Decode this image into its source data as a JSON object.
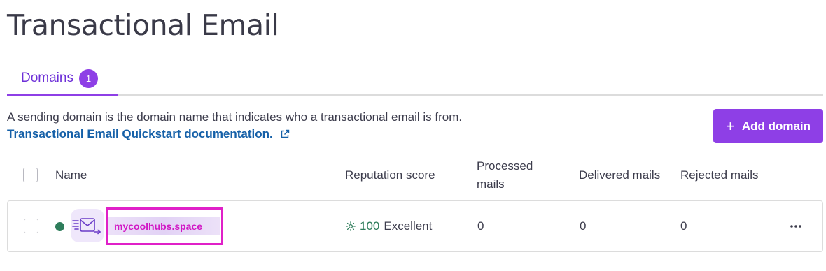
{
  "page": {
    "title": "Transactional Email"
  },
  "tabs": [
    {
      "label": "Domains",
      "badge": "1"
    }
  ],
  "intro": {
    "description": "A sending domain is the domain name that indicates who a transactional email is from.",
    "doc_link": "Transactional Email Quickstart documentation."
  },
  "actions": {
    "add_domain": "Add domain"
  },
  "table": {
    "columns": {
      "name": "Name",
      "reputation": "Reputation score",
      "processed_line1": "Processed",
      "processed_line2": "mails",
      "delivered": "Delivered mails",
      "rejected": "Rejected mails"
    },
    "rows": [
      {
        "domain": "mycoolhubs.space",
        "status": "active",
        "reputation_score": "100",
        "reputation_label": "Excellent",
        "processed": "0",
        "delivered": "0",
        "rejected": "0"
      }
    ]
  },
  "icons": {
    "external_link": "external-link-icon",
    "plus": "plus-icon",
    "domain": "email-send-icon",
    "reputation": "sun-icon",
    "more": "more-horizontal-icon"
  },
  "colors": {
    "accent": "#8e3fe6",
    "link": "#1560a8",
    "success": "#2e7d5b",
    "highlight": "#e020c8"
  }
}
